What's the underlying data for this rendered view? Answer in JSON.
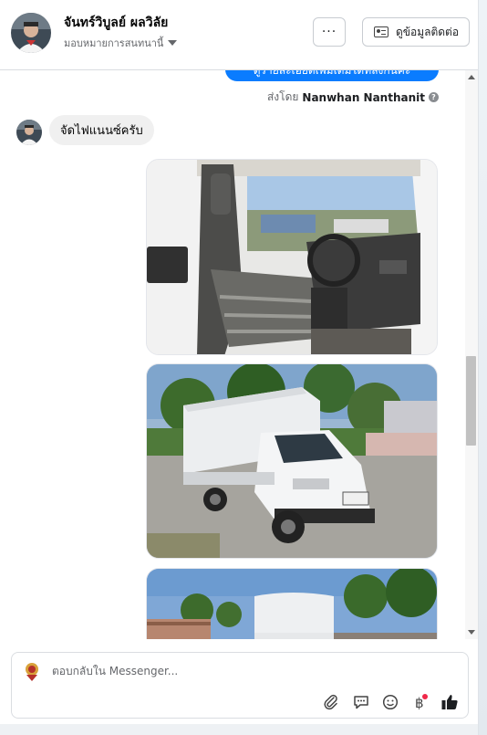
{
  "header": {
    "name": "จันทร์วิบูลย์ ผลวิลัย",
    "subtitle": "มอบหมายการสนทนานี้",
    "more_label": "···",
    "contact_label": "ดูข้อมูลติดต่อ"
  },
  "messages": {
    "sent_bubble_text": "ดูรายละเอียดเพิ่มเติมได้ที่ลิงก์นี้ค่ะ",
    "sent_by_prefix": "ส่งโดย",
    "sent_by_name": "Nanwhan Nanthanit",
    "received_text": "จัดไฟแนนซ์ครับ"
  },
  "composer": {
    "placeholder": "ตอบกลับใน Messenger..."
  },
  "icons": {
    "more": "more-icon",
    "contact": "contact-card-icon",
    "help": "help-icon",
    "attach": "paperclip-icon",
    "saved_replies": "chat-bubble-icon",
    "emoji": "emoji-icon",
    "payment": "baht-icon",
    "like": "thumbs-up-icon"
  },
  "colors": {
    "accent": "#0a7cff",
    "like": "#1c1e21",
    "notification_dot": "#f02849"
  }
}
